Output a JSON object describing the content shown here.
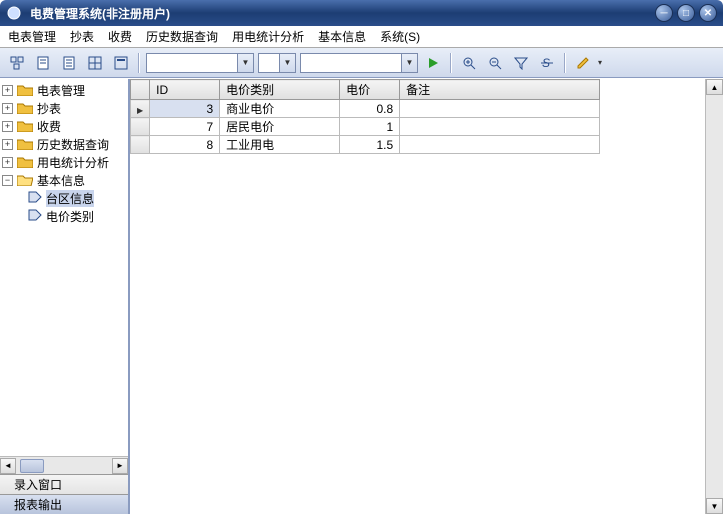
{
  "title": "电费管理系统(非注册用户)",
  "menu": {
    "m1": "电表管理",
    "m2": "抄表",
    "m3": "收费",
    "m4": "历史数据查询",
    "m5": "用电统计分析",
    "m6": "基本信息",
    "m7": "系统(S)"
  },
  "sidebar": {
    "tree": {
      "n1": "电表管理",
      "n2": "抄表",
      "n3": "收费",
      "n4": "历史数据查询",
      "n5": "用电统计分析",
      "n6": "基本信息",
      "c1": "台区信息",
      "c2": "电价类别"
    },
    "tabs": {
      "t1": "录入窗口",
      "t2": "报表输出"
    }
  },
  "grid": {
    "headers": {
      "h1": "ID",
      "h2": "电价类别",
      "h3": "电价",
      "h4": "备注"
    },
    "rows": [
      {
        "id": "3",
        "cat": "商业电价",
        "price": "0.8",
        "note": ""
      },
      {
        "id": "7",
        "cat": "居民电价",
        "price": "1",
        "note": ""
      },
      {
        "id": "8",
        "cat": "工业用电",
        "price": "1.5",
        "note": ""
      }
    ]
  }
}
